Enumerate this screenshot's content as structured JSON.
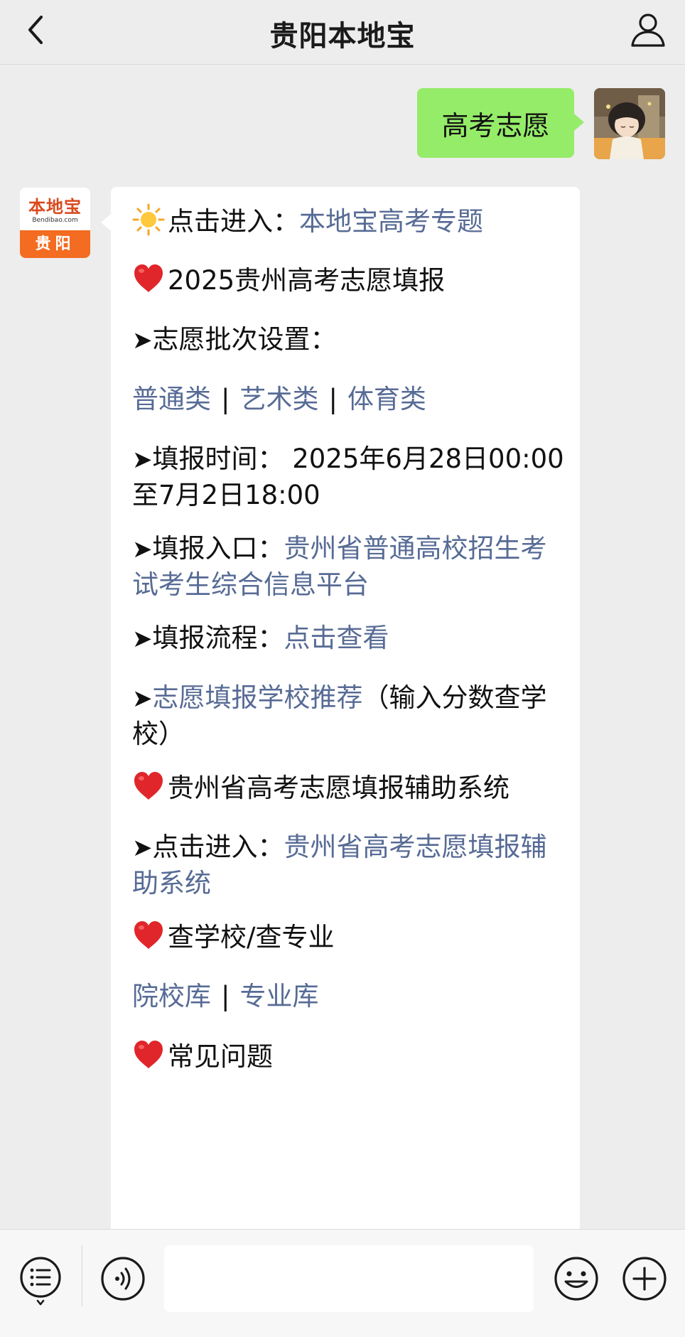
{
  "header": {
    "title": "贵阳本地宝"
  },
  "user_message": {
    "text": "高考志愿"
  },
  "bot_avatar": {
    "brand": "本地宝",
    "domain": "Bendibao.com",
    "city": "贵阳"
  },
  "bot_message": {
    "l1_prefix": "点击进入：",
    "l1_link": "本地宝高考专题",
    "l2_text": "2025贵州高考志愿填报",
    "arrow": "➤",
    "l3_text": "志愿批次设置：",
    "l4_links": [
      "普通类",
      "艺术类",
      "体育类"
    ],
    "l4_sep": "|",
    "l5_text": "填报时间： 2025年6月28日00:00至7月2日18:00",
    "l6_prefix": "填报入口：",
    "l6_link": "贵州省普通高校招生考试考生综合信息平台",
    "l7_prefix": "填报流程：",
    "l7_link": "点击查看",
    "l8_link": "志愿填报学校推荐",
    "l8_suffix": "（输入分数查学校）",
    "l9_text": "贵州省高考志愿填报辅助系统",
    "l10_prefix": "点击进入：",
    "l10_link": "贵州省高考志愿填报辅助系统",
    "l11_text": "查学校/查专业",
    "l12_links": [
      "院校库",
      "专业库"
    ],
    "l13_text": "常见问题"
  },
  "input_bar": {
    "placeholder": ""
  },
  "colors": {
    "link": "#576b95",
    "my_bubble": "#95ec69",
    "background": "#ededed"
  },
  "icons": [
    "back-chevron-icon",
    "person-icon",
    "sun-emoji-icon",
    "red-heart-emoji-icon",
    "menu-list-icon",
    "voice-icon",
    "smiley-icon",
    "plus-icon"
  ]
}
